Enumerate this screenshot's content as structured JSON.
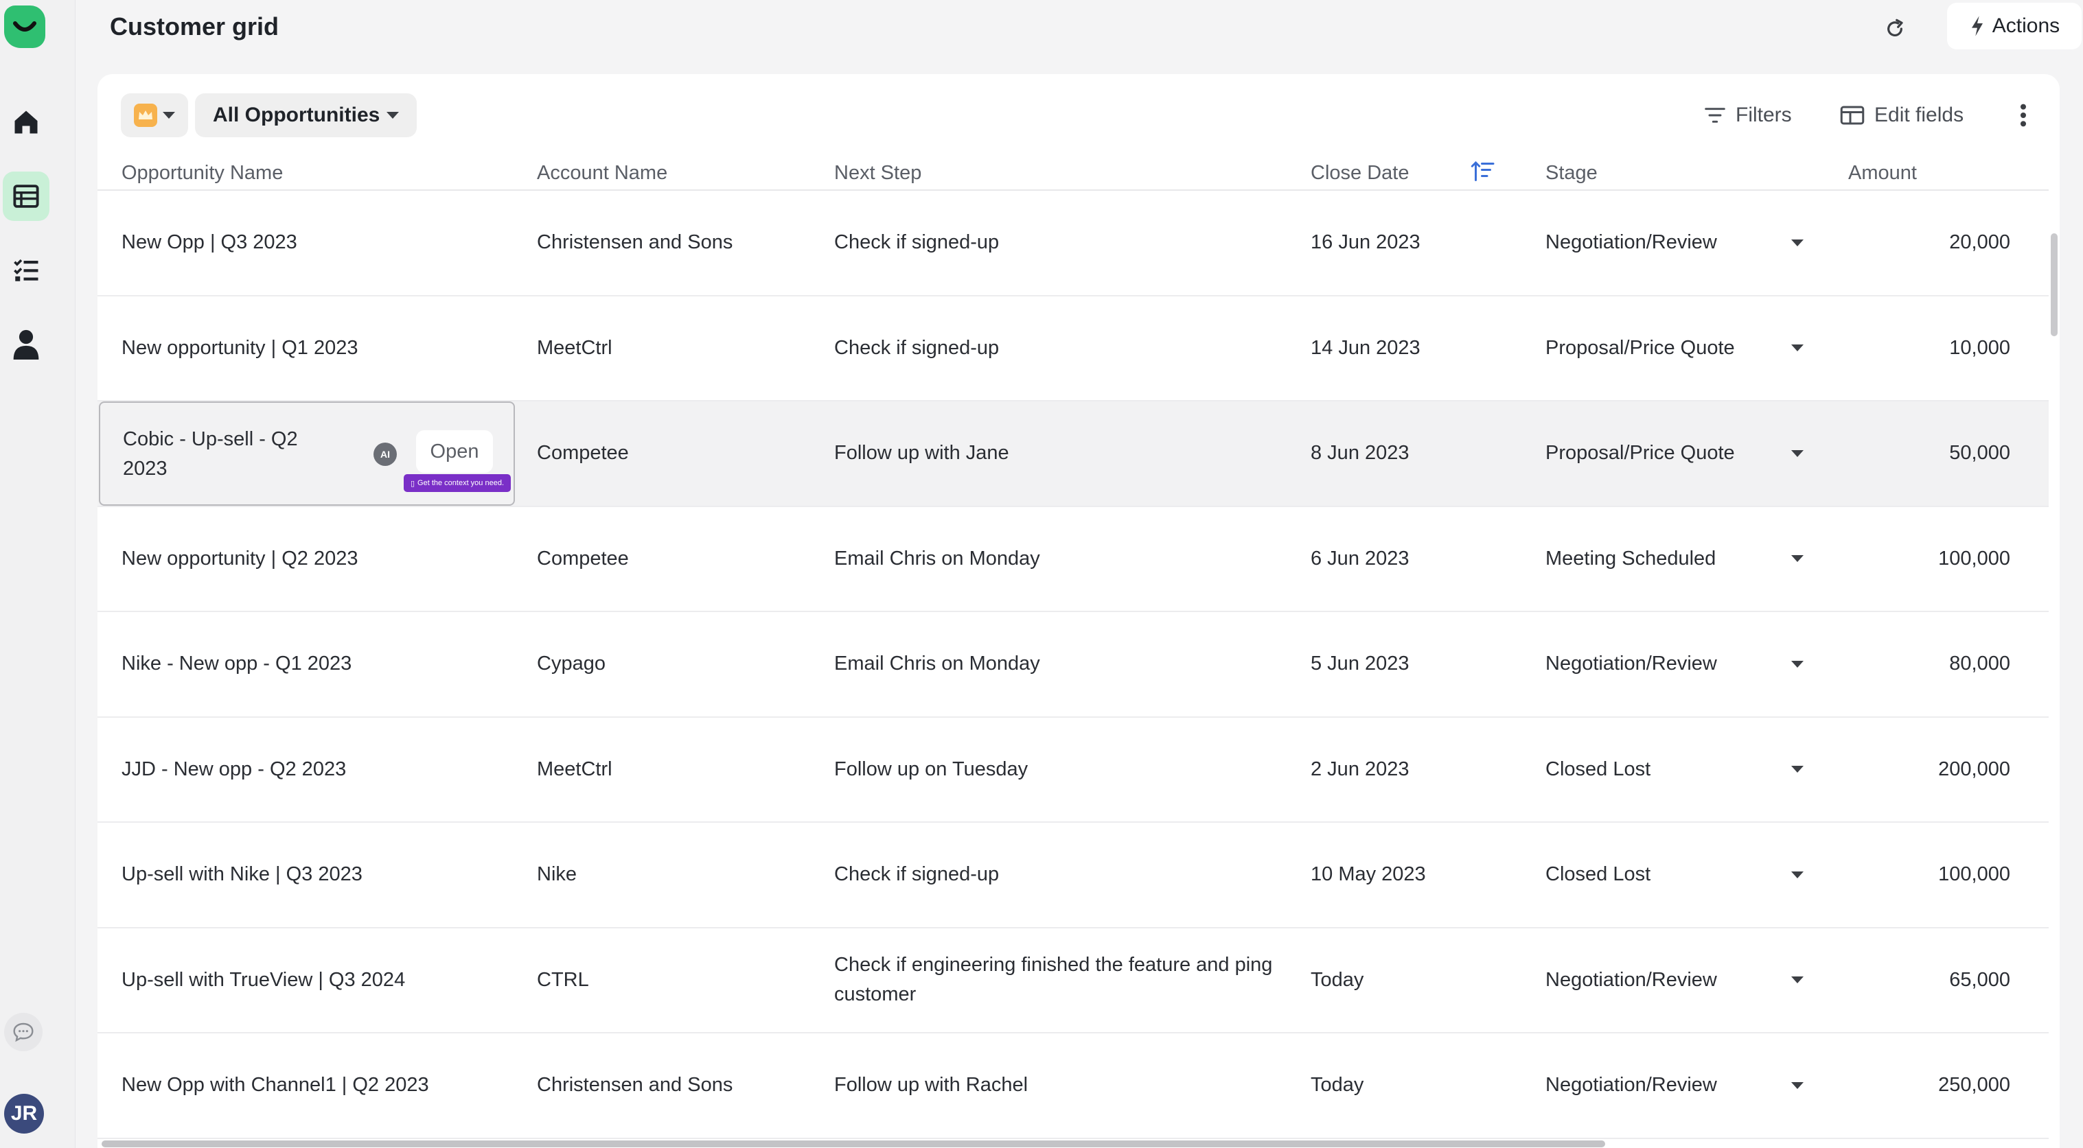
{
  "app": {
    "title": "Customer grid",
    "user_initials": "JR",
    "brand_color": "#2fbf71"
  },
  "header": {
    "actions_label": "Actions"
  },
  "toolbar": {
    "view_name": "All Opportunities",
    "filters_label": "Filters",
    "edit_fields_label": "Edit fields"
  },
  "table": {
    "columns": [
      "Opportunity Name",
      "Account Name",
      "Next Step",
      "Close Date",
      "Stage",
      "Amount"
    ],
    "sort_column": "Close Date",
    "rows": [
      {
        "name": "New Opp | Q3 2023",
        "account": "Christensen and Sons",
        "next_step": "Check if signed-up",
        "close_date": "16 Jun 2023",
        "stage": "Negotiation/Review",
        "amount": "20,000"
      },
      {
        "name": "New opportunity | Q1 2023",
        "account": "MeetCtrl",
        "next_step": "Check if signed-up",
        "close_date": "14 Jun 2023",
        "stage": "Proposal/Price Quote",
        "amount": "10,000"
      },
      {
        "name": "Cobic - Up-sell - Q2 2023",
        "account": "Competee",
        "next_step": "Follow up with Jane",
        "close_date": "8 Jun 2023",
        "stage": "Proposal/Price Quote",
        "amount": "50,000"
      },
      {
        "name": "New opportunity | Q2 2023",
        "account": "Competee",
        "next_step": "Email Chris on Monday",
        "close_date": "6 Jun 2023",
        "stage": "Meeting Scheduled",
        "amount": "100,000"
      },
      {
        "name": "Nike - New opp - Q1 2023",
        "account": "Cypago",
        "next_step": "Email Chris on Monday",
        "close_date": "5 Jun 2023",
        "stage": "Negotiation/Review",
        "amount": "80,000"
      },
      {
        "name": "JJD - New opp - Q2 2023",
        "account": "MeetCtrl",
        "next_step": "Follow up on Tuesday",
        "close_date": "2 Jun 2023",
        "stage": "Closed Lost",
        "amount": "200,000"
      },
      {
        "name": "Up-sell with Nike | Q3 2023",
        "account": "Nike",
        "next_step": "Check if signed-up",
        "close_date": "10 May 2023",
        "stage": "Closed Lost",
        "amount": "100,000"
      },
      {
        "name": "Up-sell with TrueView | Q3 2024",
        "account": "CTRL",
        "next_step": "Check if engineering finished the feature and ping customer",
        "close_date": "Today",
        "stage": "Negotiation/Review",
        "amount": "65,000"
      },
      {
        "name": "New Opp with Channel1 | Q2 2023",
        "account": "Christensen and Sons",
        "next_step": "Follow up with Rachel",
        "close_date": "Today",
        "stage": "Negotiation/Review",
        "amount": "250,000"
      }
    ]
  },
  "hover_cell": {
    "ai_badge": "AI",
    "open_label": "Open",
    "tooltip": "Get the context you need."
  }
}
